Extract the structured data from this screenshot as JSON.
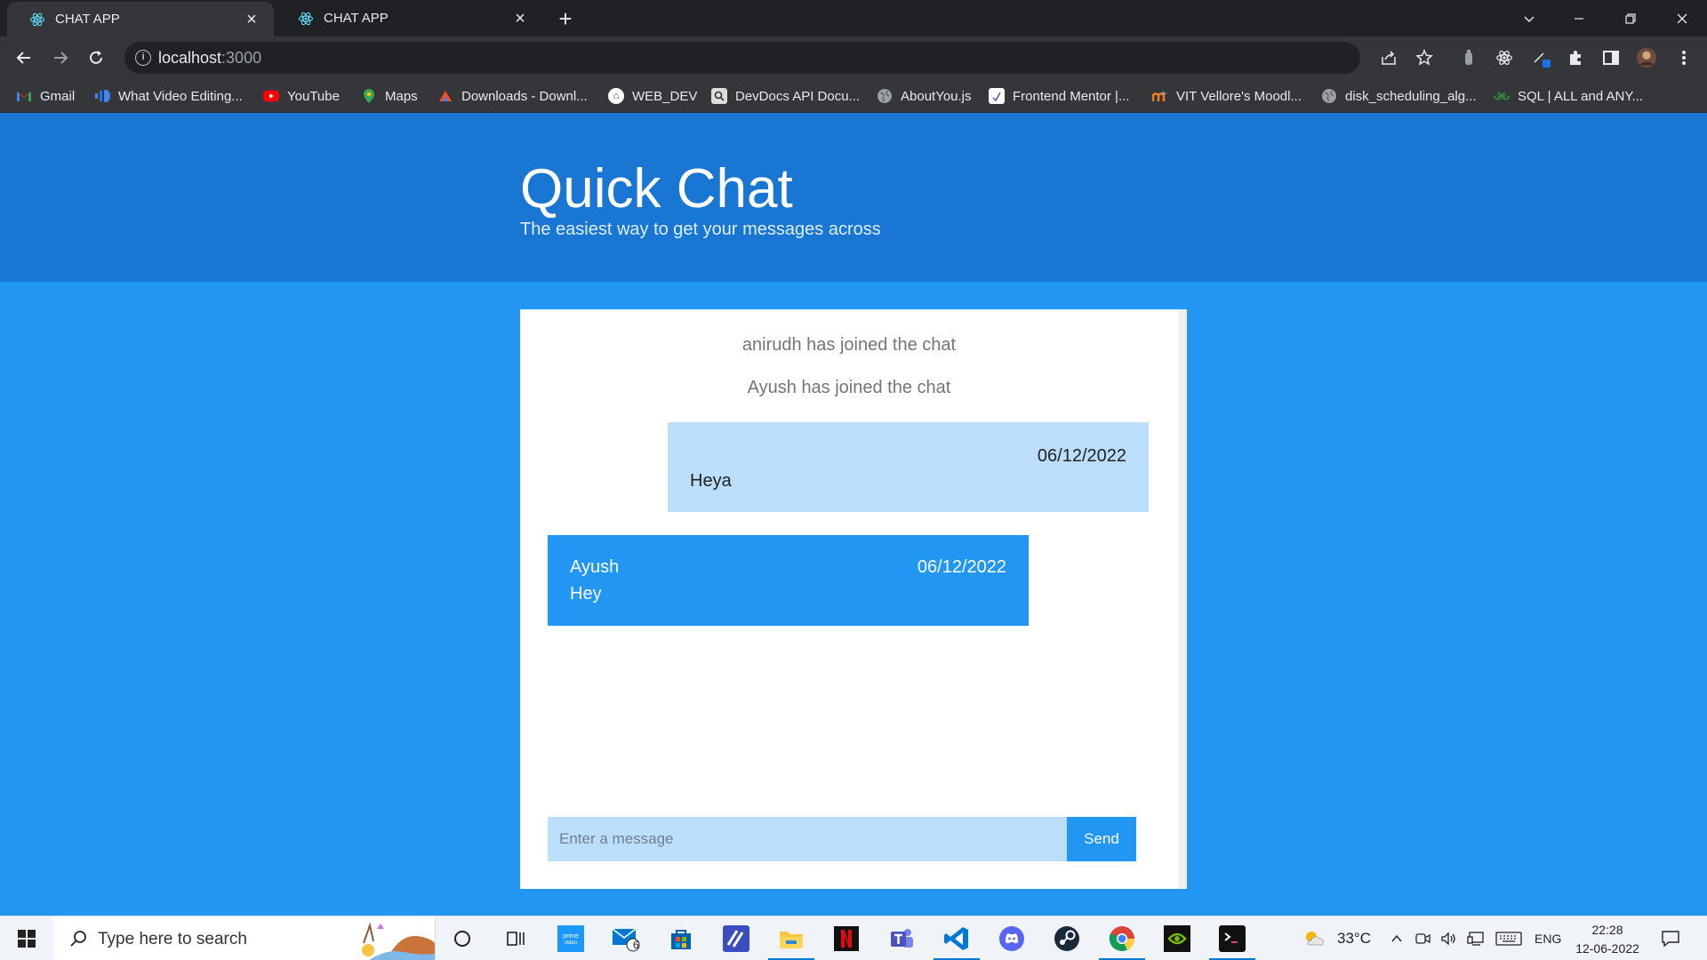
{
  "browser": {
    "tabs": [
      {
        "title": "CHAT APP",
        "active": true
      },
      {
        "title": "CHAT APP",
        "active": false
      }
    ],
    "url": {
      "host": "localhost",
      "port": ":3000"
    },
    "bookmarks": [
      {
        "label": "Gmail",
        "icon": "gmail-icon",
        "color": "#ea4335"
      },
      {
        "label": "What Video Editing...",
        "icon": "video-editing-icon",
        "color": "#4285f4"
      },
      {
        "label": "YouTube",
        "icon": "youtube-icon",
        "color": "#ff0000"
      },
      {
        "label": "Maps",
        "icon": "maps-icon",
        "color": "#34a853"
      },
      {
        "label": "Downloads - Downl...",
        "icon": "downloads-icon",
        "color": "#f4511e"
      },
      {
        "label": "WEB_DEV",
        "icon": "web-dev-icon",
        "color": "#ffffff"
      },
      {
        "label": "DevDocs API Docu...",
        "icon": "devdocs-icon",
        "color": "#dddddd"
      },
      {
        "label": "AboutYou.js",
        "icon": "globe-icon",
        "color": "#9aa0a6"
      },
      {
        "label": "Frontend Mentor |...",
        "icon": "frontend-mentor-icon",
        "color": "#ffffff"
      },
      {
        "label": "VIT Vellore's Moodl...",
        "icon": "moodle-icon",
        "color": "#f98012"
      },
      {
        "label": "disk_scheduling_alg...",
        "icon": "globe-icon",
        "color": "#9aa0a6"
      },
      {
        "label": "SQL | ALL and ANY...",
        "icon": "geeksforgeeks-icon",
        "color": "#2f8d46"
      }
    ]
  },
  "header": {
    "title": "Quick Chat",
    "subtitle": "The easiest way to get your messages across"
  },
  "chat": {
    "joins": [
      "anirudh has joined the chat",
      "Ayush has joined the chat"
    ],
    "messages": [
      {
        "own": true,
        "name": "",
        "date": "06/12/2022",
        "text": "Heya"
      },
      {
        "own": false,
        "name": "Ayush",
        "date": "06/12/2022",
        "text": "Hey"
      }
    ],
    "input_placeholder": "Enter a message",
    "send_label": "Send"
  },
  "taskbar": {
    "search_placeholder": "Type here to search",
    "mail_badge": "6",
    "weather": "33°C",
    "language": "ENG",
    "time": "22:28",
    "date": "12-06-2022",
    "apps": [
      "prime-video-icon",
      "mail-icon",
      "store-icon",
      "sublime-icon",
      "file-explorer-icon",
      "netflix-icon",
      "teams-icon",
      "vscode-icon",
      "discord-icon",
      "steam-icon",
      "chrome-icon",
      "nvidia-icon",
      "terminal-icon"
    ]
  }
}
